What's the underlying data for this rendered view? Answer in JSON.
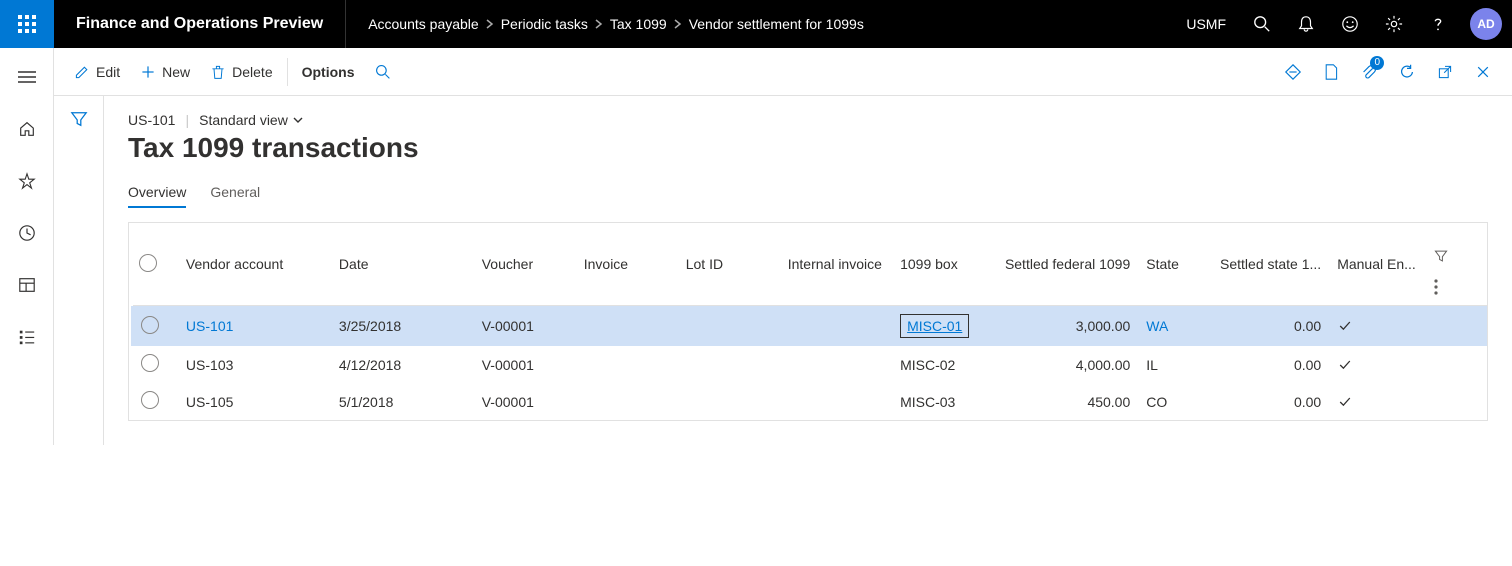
{
  "header": {
    "app_title": "Finance and Operations Preview",
    "entity": "USMF",
    "avatar_initials": "AD",
    "breadcrumbs": [
      "Accounts payable",
      "Periodic tasks",
      "Tax 1099",
      "Vendor settlement for 1099s"
    ]
  },
  "actions": {
    "edit": "Edit",
    "new": "New",
    "delete": "Delete",
    "options": "Options"
  },
  "toolbar_badge": "0",
  "page": {
    "record_id": "US-101",
    "view_name": "Standard view",
    "title": "Tax 1099 transactions"
  },
  "tabs": [
    "Overview",
    "General"
  ],
  "active_tab": 0,
  "grid": {
    "columns": [
      "Vendor account",
      "Date",
      "Voucher",
      "Invoice",
      "Lot ID",
      "Internal invoice",
      "1099 box",
      "Settled federal 1099",
      "State",
      "Settled state 1...",
      "Manual En..."
    ],
    "rows": [
      {
        "selected": true,
        "vendor": "US-101",
        "date": "3/25/2018",
        "voucher": "V-00001",
        "invoice": "",
        "lot": "",
        "internal": "",
        "box": "MISC-01",
        "box_active": true,
        "fed": "3,000.00",
        "state": "WA",
        "sstate": "0.00",
        "manual": true
      },
      {
        "selected": false,
        "vendor": "US-103",
        "date": "4/12/2018",
        "voucher": "V-00001",
        "invoice": "",
        "lot": "",
        "internal": "",
        "box": "MISC-02",
        "box_active": false,
        "fed": "4,000.00",
        "state": "IL",
        "sstate": "0.00",
        "manual": true
      },
      {
        "selected": false,
        "vendor": "US-105",
        "date": "5/1/2018",
        "voucher": "V-00001",
        "invoice": "",
        "lot": "",
        "internal": "",
        "box": "MISC-03",
        "box_active": false,
        "fed": "450.00",
        "state": "CO",
        "sstate": "0.00",
        "manual": true
      }
    ]
  }
}
